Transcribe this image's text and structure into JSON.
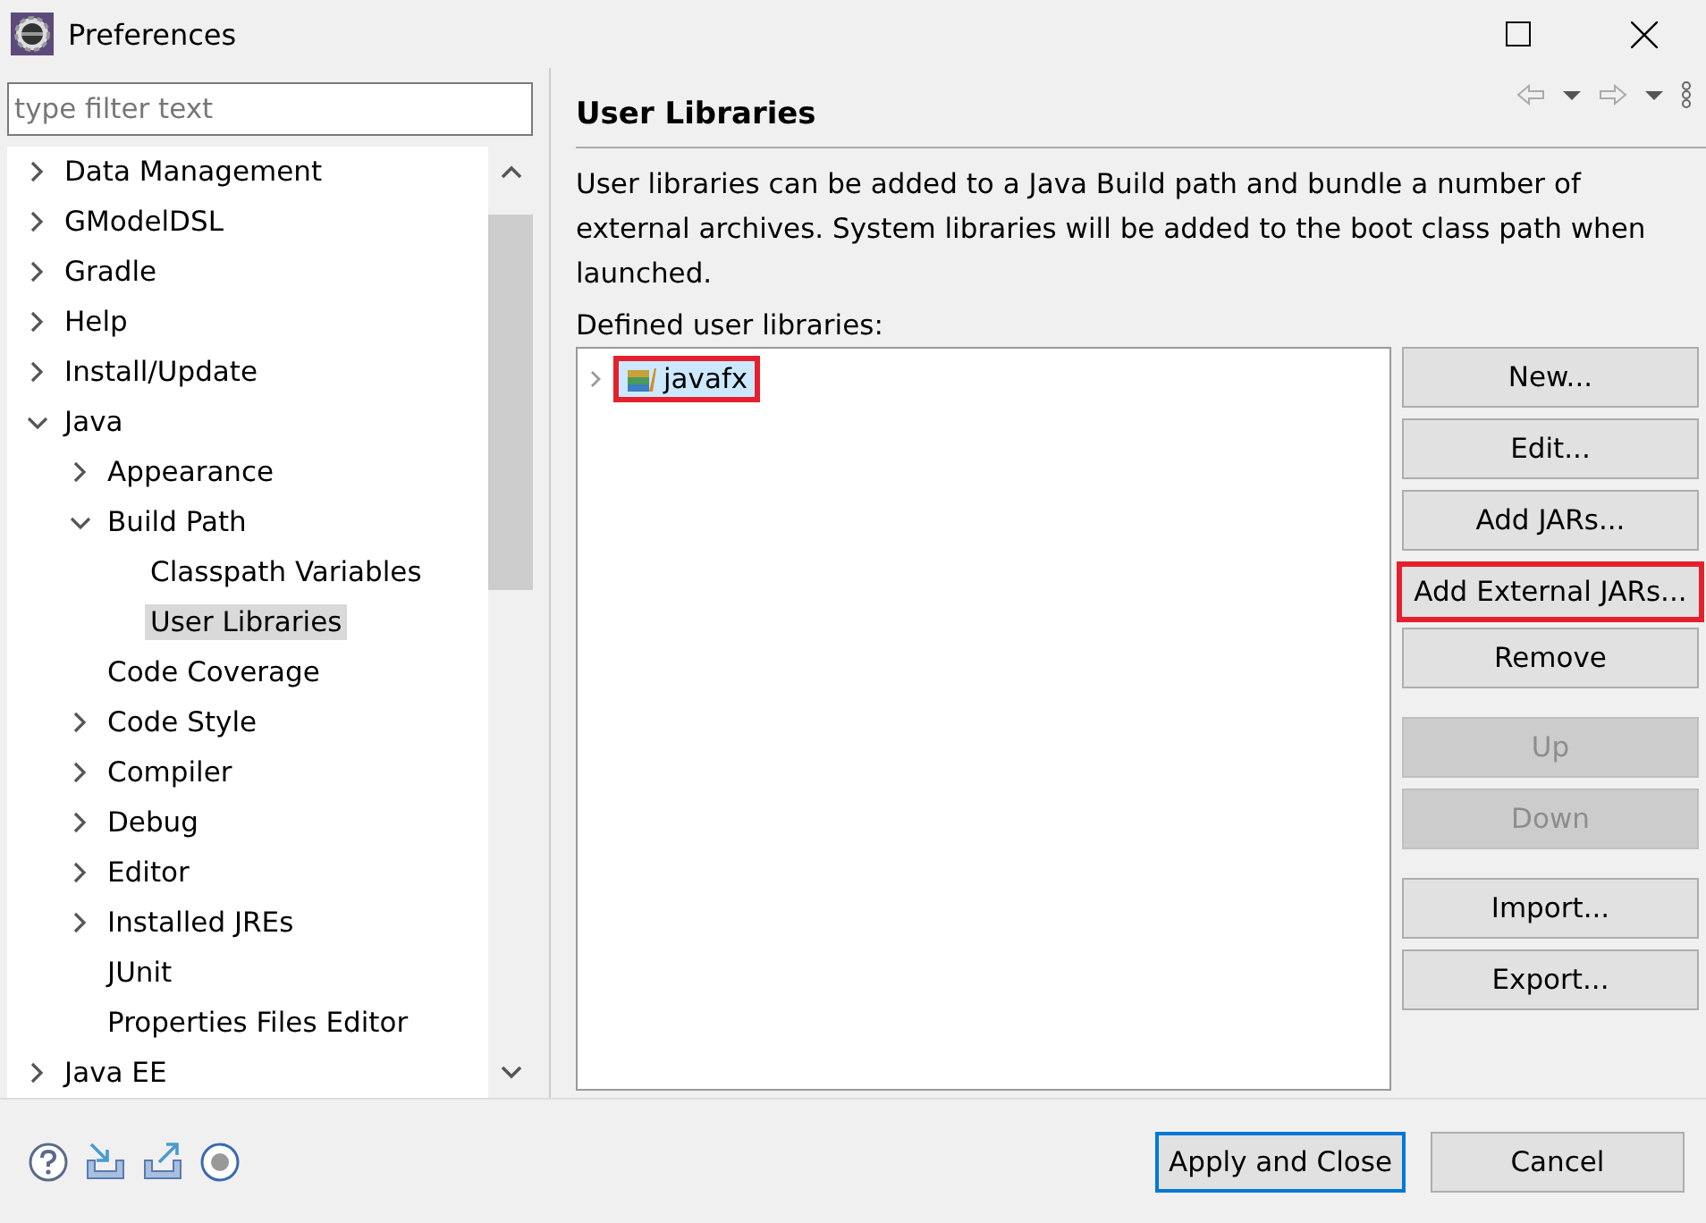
{
  "window": {
    "title": "Preferences"
  },
  "filter": {
    "placeholder": "type filter text"
  },
  "tree": [
    {
      "label": "Data Management",
      "kind": "branch",
      "expanded": false,
      "selected": false
    },
    {
      "label": "GModelDSL",
      "kind": "branch",
      "expanded": false,
      "selected": false
    },
    {
      "label": "Gradle",
      "kind": "branch",
      "expanded": false,
      "selected": false
    },
    {
      "label": "Help",
      "kind": "branch",
      "expanded": false,
      "selected": false
    },
    {
      "label": "Install/Update",
      "kind": "branch",
      "expanded": false,
      "selected": false
    },
    {
      "label": "Java",
      "kind": "branch",
      "expanded": true,
      "selected": false,
      "children": [
        {
          "label": "Appearance",
          "kind": "branch",
          "expanded": false,
          "selected": false
        },
        {
          "label": "Build Path",
          "kind": "branch",
          "expanded": true,
          "selected": false,
          "children": [
            {
              "label": "Classpath Variables",
              "kind": "leaf",
              "selected": false
            },
            {
              "label": "User Libraries",
              "kind": "leaf",
              "selected": true
            }
          ]
        },
        {
          "label": "Code Coverage",
          "kind": "leaf",
          "selected": false
        },
        {
          "label": "Code Style",
          "kind": "branch",
          "expanded": false,
          "selected": false
        },
        {
          "label": "Compiler",
          "kind": "branch",
          "expanded": false,
          "selected": false
        },
        {
          "label": "Debug",
          "kind": "branch",
          "expanded": false,
          "selected": false
        },
        {
          "label": "Editor",
          "kind": "branch",
          "expanded": false,
          "selected": false
        },
        {
          "label": "Installed JREs",
          "kind": "branch",
          "expanded": false,
          "selected": false
        },
        {
          "label": "JUnit",
          "kind": "leaf",
          "selected": false
        },
        {
          "label": "Properties Files Editor",
          "kind": "leaf",
          "selected": false
        }
      ]
    },
    {
      "label": "Java EE",
      "kind": "branch",
      "expanded": false,
      "selected": false
    }
  ],
  "page": {
    "title": "User Libraries",
    "description": "User libraries can be added to a Java Build path and bundle a number of external archives. System libraries will be added to the boot class path when launched.",
    "list_label": "Defined user libraries:",
    "libraries": [
      {
        "name": "javafx",
        "expanded": false,
        "selected": true,
        "highlighted": true
      }
    ],
    "buttons": [
      {
        "label": "New...",
        "disabled": false,
        "highlighted": false
      },
      {
        "label": "Edit...",
        "disabled": false,
        "highlighted": false
      },
      {
        "label": "Add JARs...",
        "disabled": false,
        "highlighted": false
      },
      {
        "label": "Add External JARs...",
        "disabled": false,
        "highlighted": true
      },
      {
        "label": "Remove",
        "disabled": false,
        "highlighted": false
      },
      {
        "label": "Up",
        "disabled": true,
        "highlighted": false,
        "gap": true
      },
      {
        "label": "Down",
        "disabled": true,
        "highlighted": false
      },
      {
        "label": "Import...",
        "disabled": false,
        "highlighted": false,
        "gap": true
      },
      {
        "label": "Export...",
        "disabled": false,
        "highlighted": false
      }
    ]
  },
  "footer": {
    "buttons": [
      {
        "label": "Apply and Close",
        "default": true
      },
      {
        "label": "Cancel",
        "default": false
      }
    ]
  }
}
